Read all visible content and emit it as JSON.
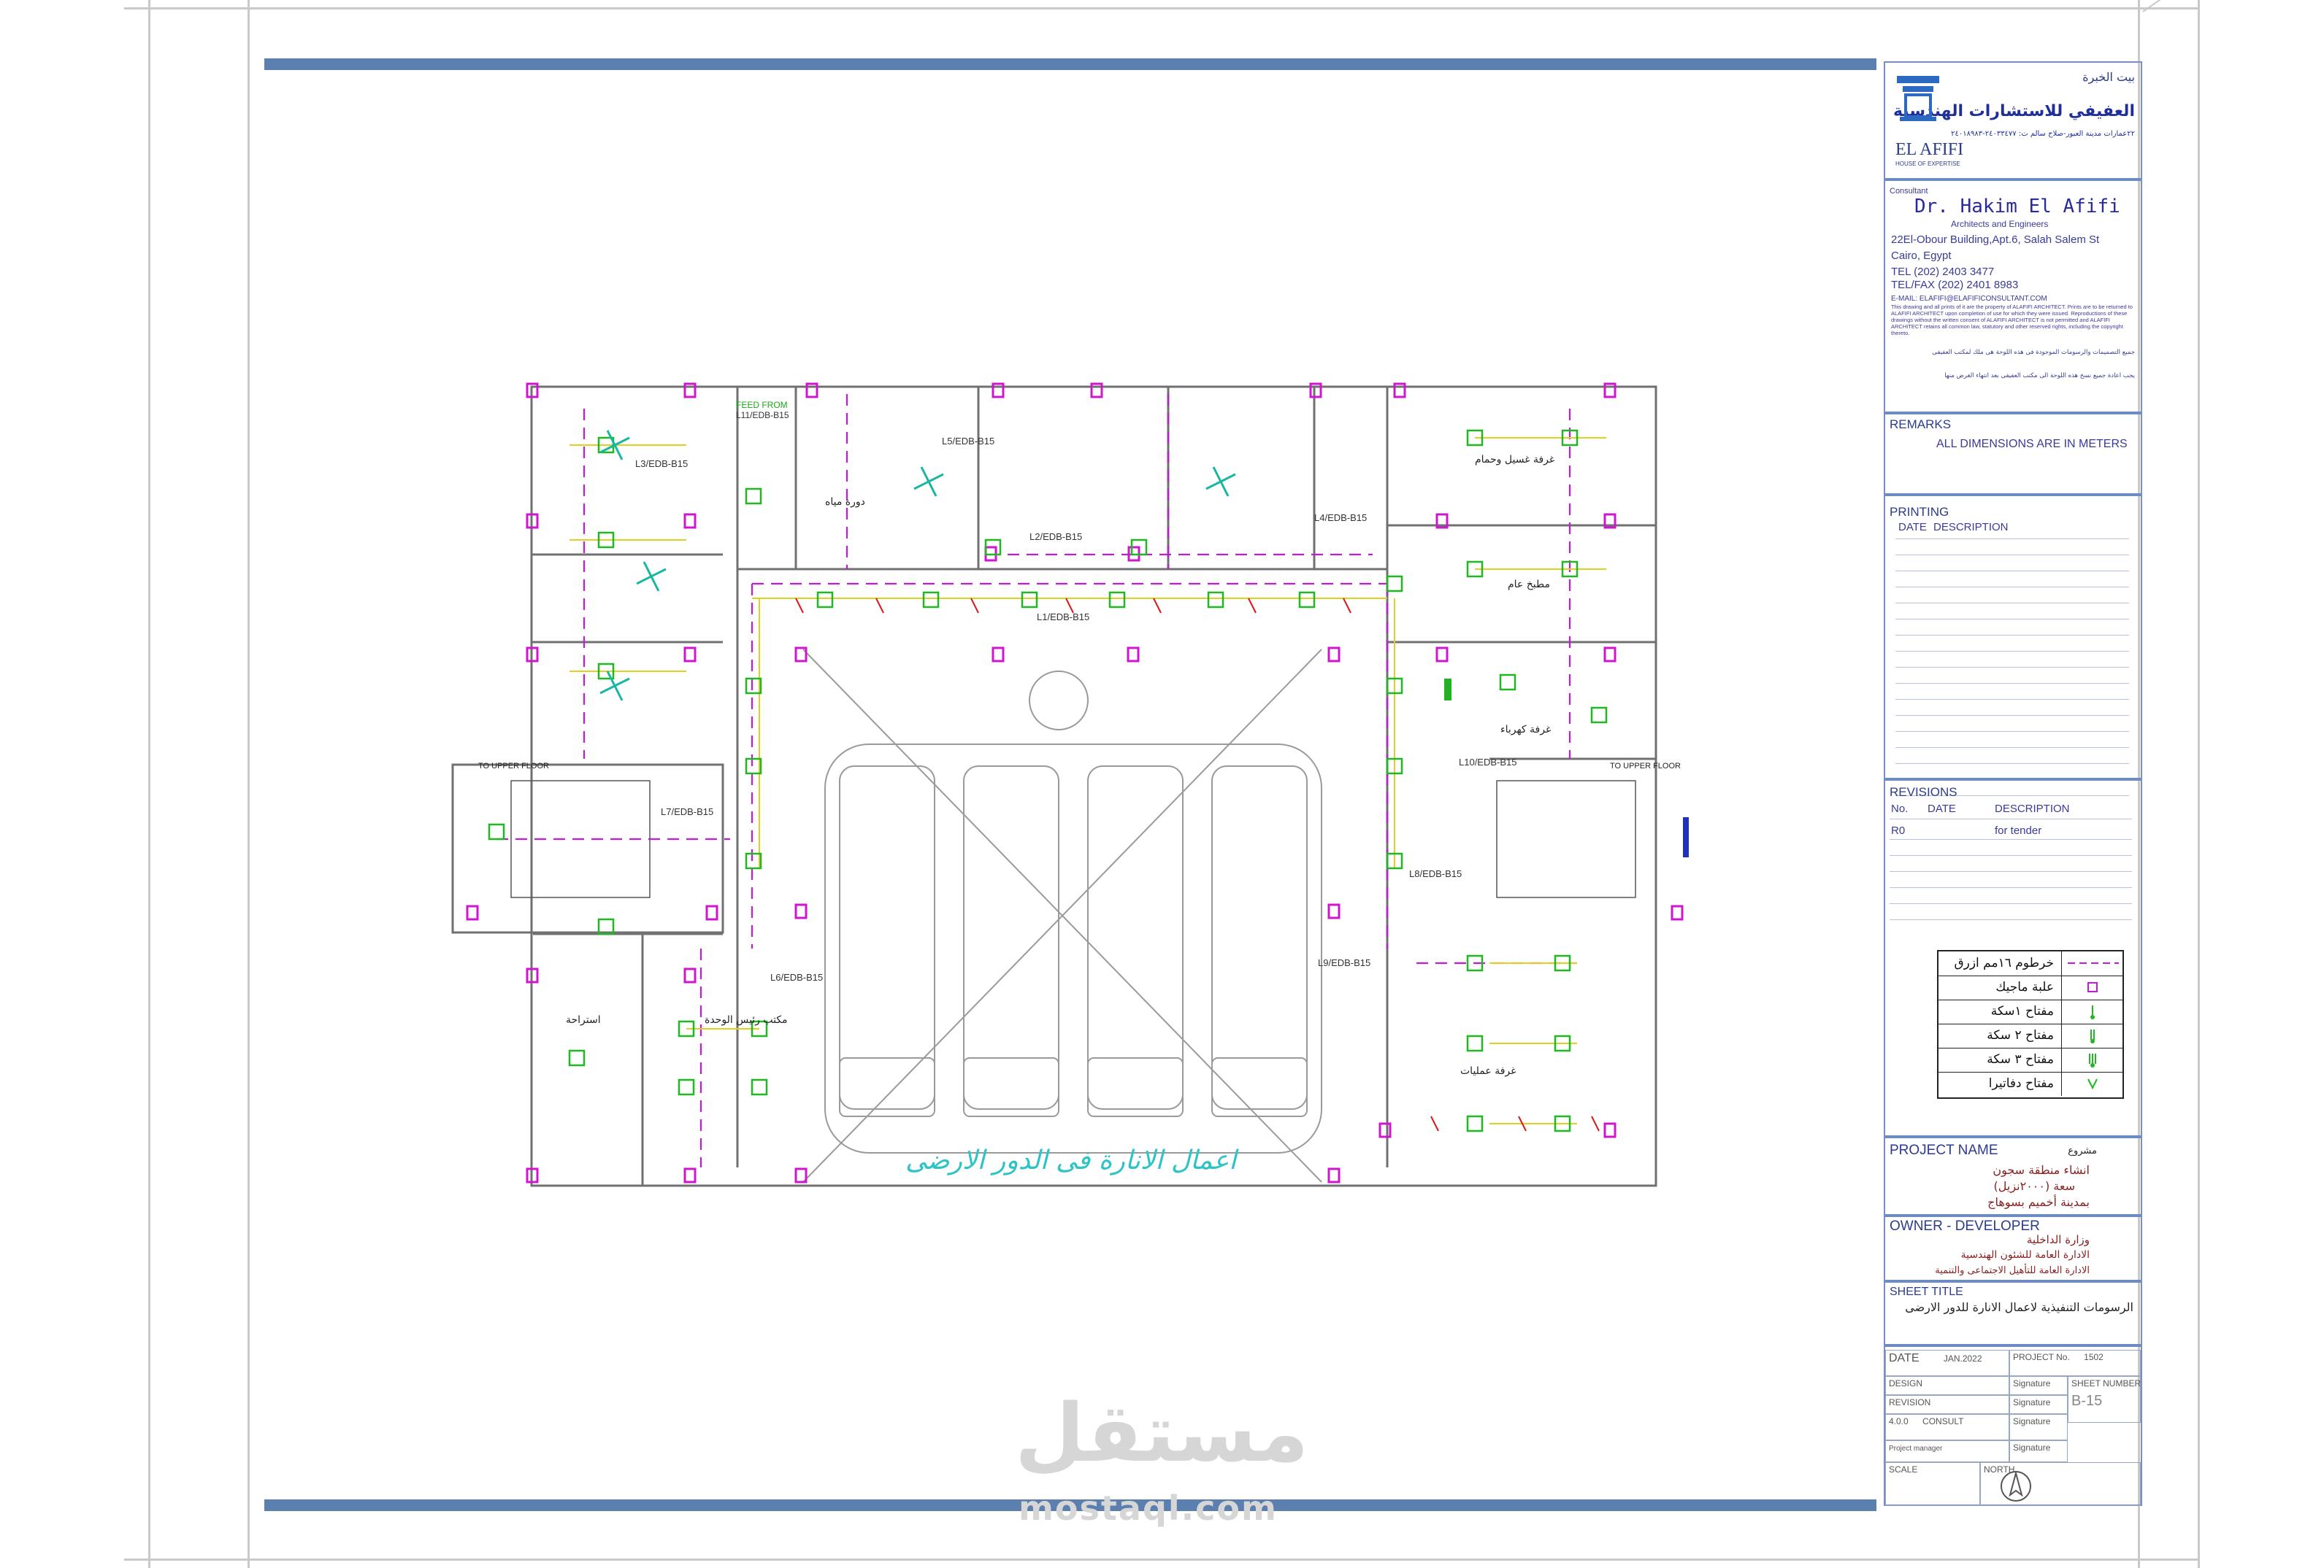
{
  "plan": {
    "title_ar": "اعمال الانارة فى الدور الارضى",
    "feed_note": "FEED FROM",
    "feed_panel": "L11/EDB-B15",
    "circuit_labels": [
      "L3/EDB-B15",
      "L5/EDB-B15",
      "L2/EDB-B15",
      "L4/EDB-B15",
      "L1/EDB-B15",
      "L7/EDB-B15",
      "L6/EDB-B15",
      "L9/EDB-B15",
      "L10/EDB-B15",
      "L8/EDB-B15",
      "L11/EDB-B15"
    ],
    "upper_floor_left": "TO UPPER FLOOR",
    "upper_floor_right": "TO UPPER FLOOR",
    "room_labels_ar": [
      "غرفة غسيل وحمام",
      "مطبخ عام",
      "غرفة كهرباء",
      "غرفة عمليات",
      "مكتب رئيس الوحدة",
      "استراحة",
      "دورة مياه"
    ]
  },
  "titleblock": {
    "logo": {
      "top_ar": "بيت الخبرة",
      "firm_ar": "العفيفي للاستشارات الهندسية",
      "address_ar": "٢٢عمارات مدينة العبور-صلاح سالم ت: ٢٤٠٣٣٤٧٧-٢٤٠١٨٩٨٣",
      "brand": "EL AFIFI",
      "brand_sub": "HOUSE OF EXPERTISE"
    },
    "consultant_label": "Consultant",
    "consultant_name": "Dr. Hakim El Afifi",
    "consultant_sub": "Architects and Engineers",
    "address_1": "22El-Obour Building,Apt.6, Salah Salem St",
    "address_2": "Cairo, Egypt",
    "tel": "TEL (202) 2403 3477",
    "fax": "TEL/FAX (202) 2401 8983",
    "email": "E-MAIL: ELAFIFI@ELAFIFICONSULTANT.COM",
    "copyright_en": "This drawing and all prints of it are the property of ALAFIFI ARCHITECT. Prints are to be returned to ALAFIFI ARCHITECT upon completion of use for which they were issued. Reproductions of these drawings without the written consent of ALAFIFI ARCHITECT is not permitted and ALAFIFI ARCHITECT retains all common law, statutory and other reserved rights, including the copyright thereto.",
    "copyright_ar_1": "جميع التصميمات والرسومات الموجودة فى هذه اللوحة هى ملك لمكتب العفيفى",
    "copyright_ar_2": "يجب اعادة جميع نسخ هذه اللوحة الى مكتب العفيفى بعد انتهاء الغرض منها",
    "remarks_label": "REMARKS",
    "remarks_text": "ALL DIMENSIONS ARE IN METERS",
    "printing_label": "PRINTING",
    "printing_cols": [
      "DATE",
      "DESCRIPTION"
    ],
    "revisions_label": "REVISIONS",
    "revisions_cols": [
      "No.",
      "DATE",
      "DESCRIPTION"
    ],
    "revisions_rows": [
      {
        "no": "R0",
        "date": "",
        "desc": "for tender"
      }
    ],
    "legend": [
      {
        "label": "خرطوم ١٦مم ازرق",
        "symbol": "dash-line"
      },
      {
        "label": "علبة ماجيك",
        "symbol": "box"
      },
      {
        "label": "مفتاح ١سكة",
        "symbol": "switch-1"
      },
      {
        "label": "مفتاح ٢ سكة",
        "symbol": "switch-2"
      },
      {
        "label": "مفتاح ٣ سكة",
        "symbol": "switch-3"
      },
      {
        "label": "مفتاح دفاتيرا",
        "symbol": "switch-v"
      }
    ],
    "project_label": "PROJECT NAME",
    "project_ar_1": "مشروع",
    "project_ar_2": "انشاء منطقة سجون",
    "project_ar_3": "سعة (٢٠٠٠نزيل)",
    "project_ar_4": "بمدينة أخميم بسوهاج",
    "owner_label": "OWNER - DEVELOPER",
    "owner_ar_1": "وزارة الداخلية",
    "owner_ar_2": "الادارة العامة للشئون الهندسية",
    "owner_ar_3": "الادارة العامة للتأهيل الاجتماعى والتنمية",
    "sheet_title_label": "SHEET TITLE",
    "sheet_title_ar": "الرسومات التنفيذية لاعمال الانارة للدور الارضى",
    "stamp": {
      "date_label": "DATE",
      "date_val": "JAN.2022",
      "project_no_label": "PROJECT No.",
      "project_no_val": "1502",
      "design_label": "DESIGN",
      "revision_label": "REVISION",
      "consult_label": "CONSULT",
      "project_manager_label": "Project manager",
      "scale_label": "SCALE",
      "north_label": "NORTH",
      "signature_label": "Signature",
      "sheet_number_label": "SHEET NUMBER",
      "sheet_number_val": "B-15",
      "rev_code": "4.0.0"
    }
  },
  "watermark": {
    "ar": "مستقل",
    "en": "mostaql.com"
  }
}
